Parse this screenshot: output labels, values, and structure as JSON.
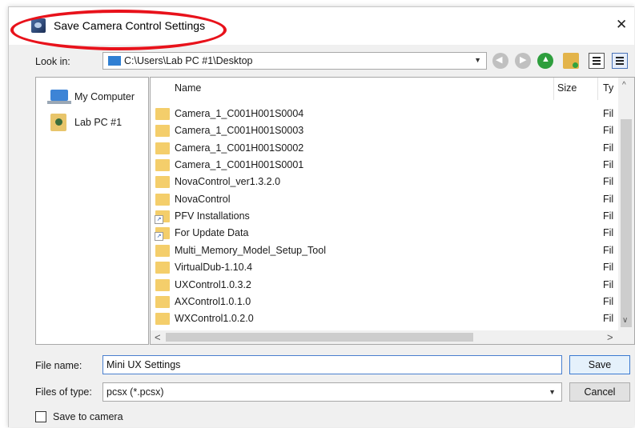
{
  "dialog": {
    "title": "Save Camera Control Settings",
    "close_glyph": "✕",
    "accent_color": "#e8121b"
  },
  "lookin": {
    "label": "Look in:",
    "value": "C:\\Users\\Lab PC #1\\Desktop",
    "arrow": "▼"
  },
  "toolbar": {
    "icons": [
      "back-icon",
      "forward-icon",
      "up-folder-icon",
      "new-folder-icon",
      "list-view-icon",
      "detail-view-icon"
    ]
  },
  "places": [
    {
      "label": "My Computer",
      "icon": "computer-icon"
    },
    {
      "label": "Lab PC #1",
      "icon": "user-folder-icon"
    }
  ],
  "columns": {
    "name": "Name",
    "size": "Size",
    "type": "Ty"
  },
  "files": [
    {
      "name": "Camera_1_C001H001S0004",
      "type": "Fil",
      "shortcut": false
    },
    {
      "name": "Camera_1_C001H001S0003",
      "type": "Fil",
      "shortcut": false
    },
    {
      "name": "Camera_1_C001H001S0002",
      "type": "Fil",
      "shortcut": false
    },
    {
      "name": "Camera_1_C001H001S0001",
      "type": "Fil",
      "shortcut": false
    },
    {
      "name": "NovaControl_ver1.3.2.0",
      "type": "Fil",
      "shortcut": false
    },
    {
      "name": "NovaControl",
      "type": "Fil",
      "shortcut": false
    },
    {
      "name": "PFV Installations",
      "type": "Fil",
      "shortcut": true
    },
    {
      "name": "For Update Data",
      "type": "Fil",
      "shortcut": true
    },
    {
      "name": "Multi_Memory_Model_Setup_Tool",
      "type": "Fil",
      "shortcut": false
    },
    {
      "name": "VirtualDub-1.10.4",
      "type": "Fil",
      "shortcut": false
    },
    {
      "name": "UXControl1.0.3.2",
      "type": "Fil",
      "shortcut": false
    },
    {
      "name": "AXControl1.0.1.0",
      "type": "Fil",
      "shortcut": false
    },
    {
      "name": "WXControl1.0.2.0",
      "type": "Fil",
      "shortcut": false
    }
  ],
  "scroll": {
    "up": "^",
    "down": "∨",
    "left": "<",
    "right": ">"
  },
  "filename": {
    "label": "File name:",
    "value": "Mini UX Settings"
  },
  "filetype": {
    "label": "Files of type:",
    "value": "pcsx (*.pcsx)",
    "arrow": "▼"
  },
  "buttons": {
    "save": "Save",
    "cancel": "Cancel"
  },
  "save_to_camera": {
    "label": "Save to camera",
    "checked": false
  }
}
